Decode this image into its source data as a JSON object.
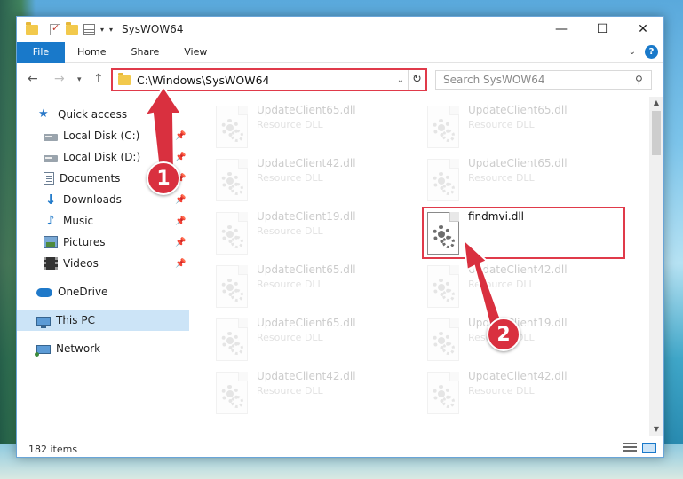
{
  "window": {
    "title": "SysWOW64",
    "controls": {
      "minimize": "—",
      "maximize": "☐",
      "close": "✕"
    }
  },
  "ribbon": {
    "tabs": [
      {
        "label": "File",
        "active": true
      },
      {
        "label": "Home"
      },
      {
        "label": "Share"
      },
      {
        "label": "View"
      }
    ],
    "help": "?"
  },
  "navigation": {
    "address": "C:\\Windows\\SysWOW64",
    "search_placeholder": "Search SysWOW64"
  },
  "sidebar": {
    "items": [
      {
        "label": "Quick access",
        "icon": "star-icon"
      },
      {
        "label": "Local Disk (C:)",
        "icon": "disk-icon",
        "pinned": true
      },
      {
        "label": "Local Disk (D:)",
        "icon": "disk-icon",
        "pinned": true
      },
      {
        "label": "Documents",
        "icon": "documents-icon",
        "pinned": true
      },
      {
        "label": "Downloads",
        "icon": "downloads-icon",
        "pinned": true
      },
      {
        "label": "Music",
        "icon": "music-icon",
        "pinned": true
      },
      {
        "label": "Pictures",
        "icon": "pictures-icon",
        "pinned": true
      },
      {
        "label": "Videos",
        "icon": "videos-icon",
        "pinned": true
      },
      {
        "label": "OneDrive",
        "icon": "onedrive-icon"
      },
      {
        "label": "This PC",
        "icon": "pc-icon",
        "selected": true
      },
      {
        "label": "Network",
        "icon": "network-icon"
      }
    ]
  },
  "files": [
    {
      "name": "UpdateClient65.dll",
      "type": "Resource DLL",
      "faded": true
    },
    {
      "name": "UpdateClient65.dll",
      "type": "Resource DLL",
      "faded": true
    },
    {
      "name": "UpdateClient42.dll",
      "type": "Resource DLL",
      "faded": true
    },
    {
      "name": "UpdateClient65.dll",
      "type": "Resource DLL",
      "faded": true
    },
    {
      "name": "UpdateClient19.dll",
      "type": "Resource DLL",
      "faded": true
    },
    {
      "name": "findmvi.dll",
      "type": "",
      "faded": false,
      "highlighted": true
    },
    {
      "name": "UpdateClient65.dll",
      "type": "Resource DLL",
      "faded": true
    },
    {
      "name": "UpdateClient42.dll",
      "type": "Resource DLL",
      "faded": true
    },
    {
      "name": "UpdateClient65.dll",
      "type": "Resource DLL",
      "faded": true
    },
    {
      "name": "UpdateClient19.dll",
      "type": "Resource DLL",
      "faded": true
    },
    {
      "name": "UpdateClient42.dll",
      "type": "Resource DLL",
      "faded": true
    },
    {
      "name": "UpdateClient42.dll",
      "type": "Resource DLL",
      "faded": true
    }
  ],
  "status": {
    "item_count": "182 items"
  },
  "annotations": {
    "step1": "1",
    "step2": "2",
    "color": "#d9303f"
  }
}
